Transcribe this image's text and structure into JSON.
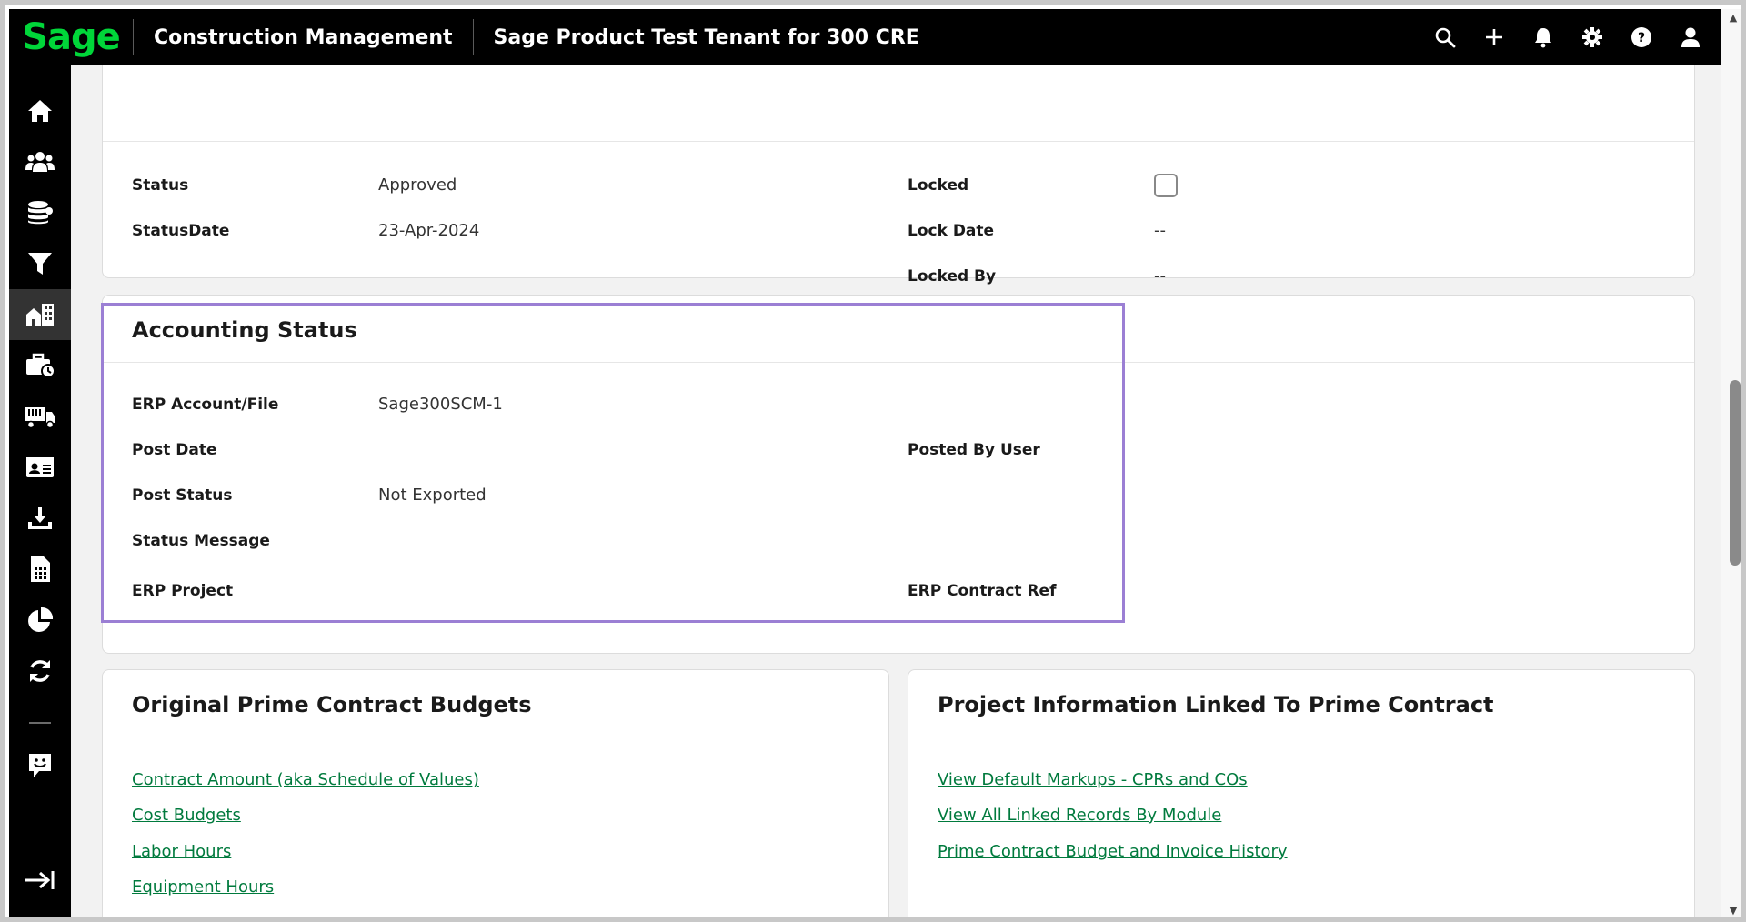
{
  "app": {
    "logo": "Sage",
    "product": "Construction Management",
    "tenant": "Sage Product Test Tenant for 300 CRE"
  },
  "top_icons": [
    "search-icon",
    "plus-icon",
    "bell-icon",
    "gear-icon",
    "help-icon",
    "user-icon"
  ],
  "sidebar": {
    "items": [
      "home-icon",
      "people-icon",
      "database-icon",
      "filter-icon",
      "buildings-icon",
      "briefcase-clock-icon",
      "truck-icon",
      "id-card-icon",
      "download-icon",
      "calculator-icon",
      "pie-chart-icon",
      "sync-icon",
      "chat-icon",
      "expand-sidebar-icon"
    ],
    "active_index": 4
  },
  "status_card": {
    "status_label": "Status",
    "status_value": "Approved",
    "status_date_label": "StatusDate",
    "status_date_value": "23-Apr-2024",
    "locked_label": "Locked",
    "lock_date_label": "Lock Date",
    "lock_date_value": "--",
    "locked_by_label": "Locked By",
    "locked_by_value": "--"
  },
  "accounting_card": {
    "title": "Accounting Status",
    "erp_account_label": "ERP Account/File",
    "erp_account_value": "Sage300SCM-1",
    "post_date_label": "Post Date",
    "posted_by_label": "Posted By User",
    "post_status_label": "Post Status",
    "post_status_value": "Not Exported",
    "status_message_label": "Status Message",
    "erp_project_label": "ERP Project",
    "erp_contract_ref_label": "ERP Contract Ref"
  },
  "budgets_card": {
    "title": "Original Prime Contract Budgets",
    "links": [
      "Contract Amount (aka Schedule of Values)",
      "Cost Budgets",
      "Labor Hours",
      "Equipment Hours"
    ]
  },
  "project_info_card": {
    "title": "Project Information Linked To Prime Contract",
    "links": [
      "View Default Markups - CPRs and COs",
      "View All Linked Records By Module",
      "Prime Contract Budget and Invoice History"
    ]
  },
  "colors": {
    "brand_green": "#00d639",
    "link_green": "#007a3d",
    "highlight_purple": "#9b7fd4",
    "topbar": "#000000"
  }
}
